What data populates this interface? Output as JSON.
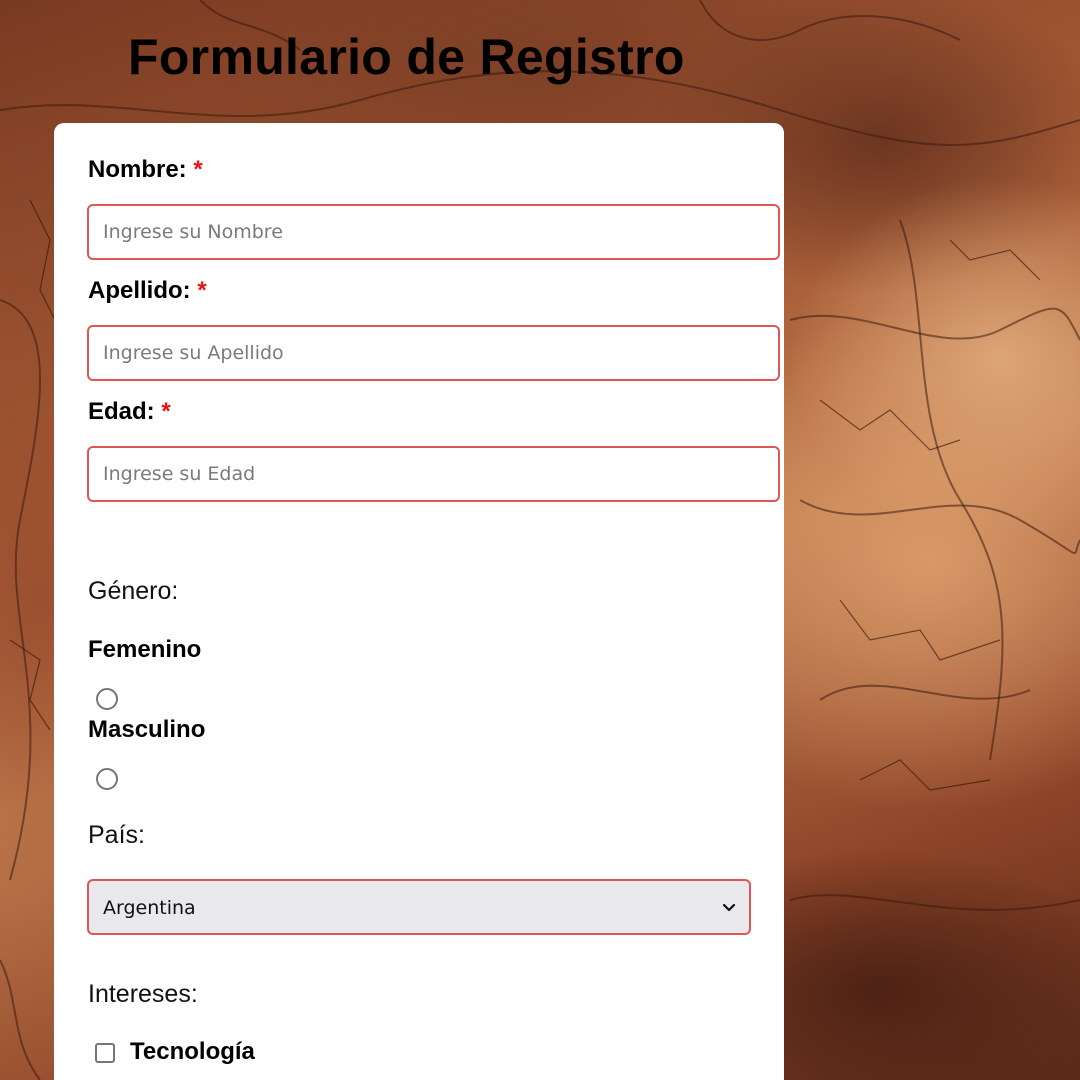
{
  "page": {
    "title": "Formulario de Registro"
  },
  "form": {
    "required_mark": "*",
    "nombre": {
      "label": "Nombre:",
      "placeholder": "Ingrese su Nombre",
      "value": ""
    },
    "apellido": {
      "label": "Apellido:",
      "placeholder": "Ingrese su Apellido",
      "value": ""
    },
    "edad": {
      "label": "Edad:",
      "placeholder": "Ingrese su Edad",
      "value": ""
    },
    "genero": {
      "label": "Género:",
      "options": [
        {
          "label": "Femenino",
          "selected": false
        },
        {
          "label": "Masculino",
          "selected": false
        }
      ]
    },
    "pais": {
      "label": "País:",
      "selected": "Argentina"
    },
    "intereses": {
      "label": "Intereses:",
      "options": [
        {
          "label": "Tecnología",
          "checked": false
        }
      ]
    }
  },
  "colors": {
    "required": "#ee1111",
    "input_border": "#e05656",
    "card_background": "#ffffff"
  },
  "icons": {
    "select_arrow": "chevron-down-icon"
  }
}
